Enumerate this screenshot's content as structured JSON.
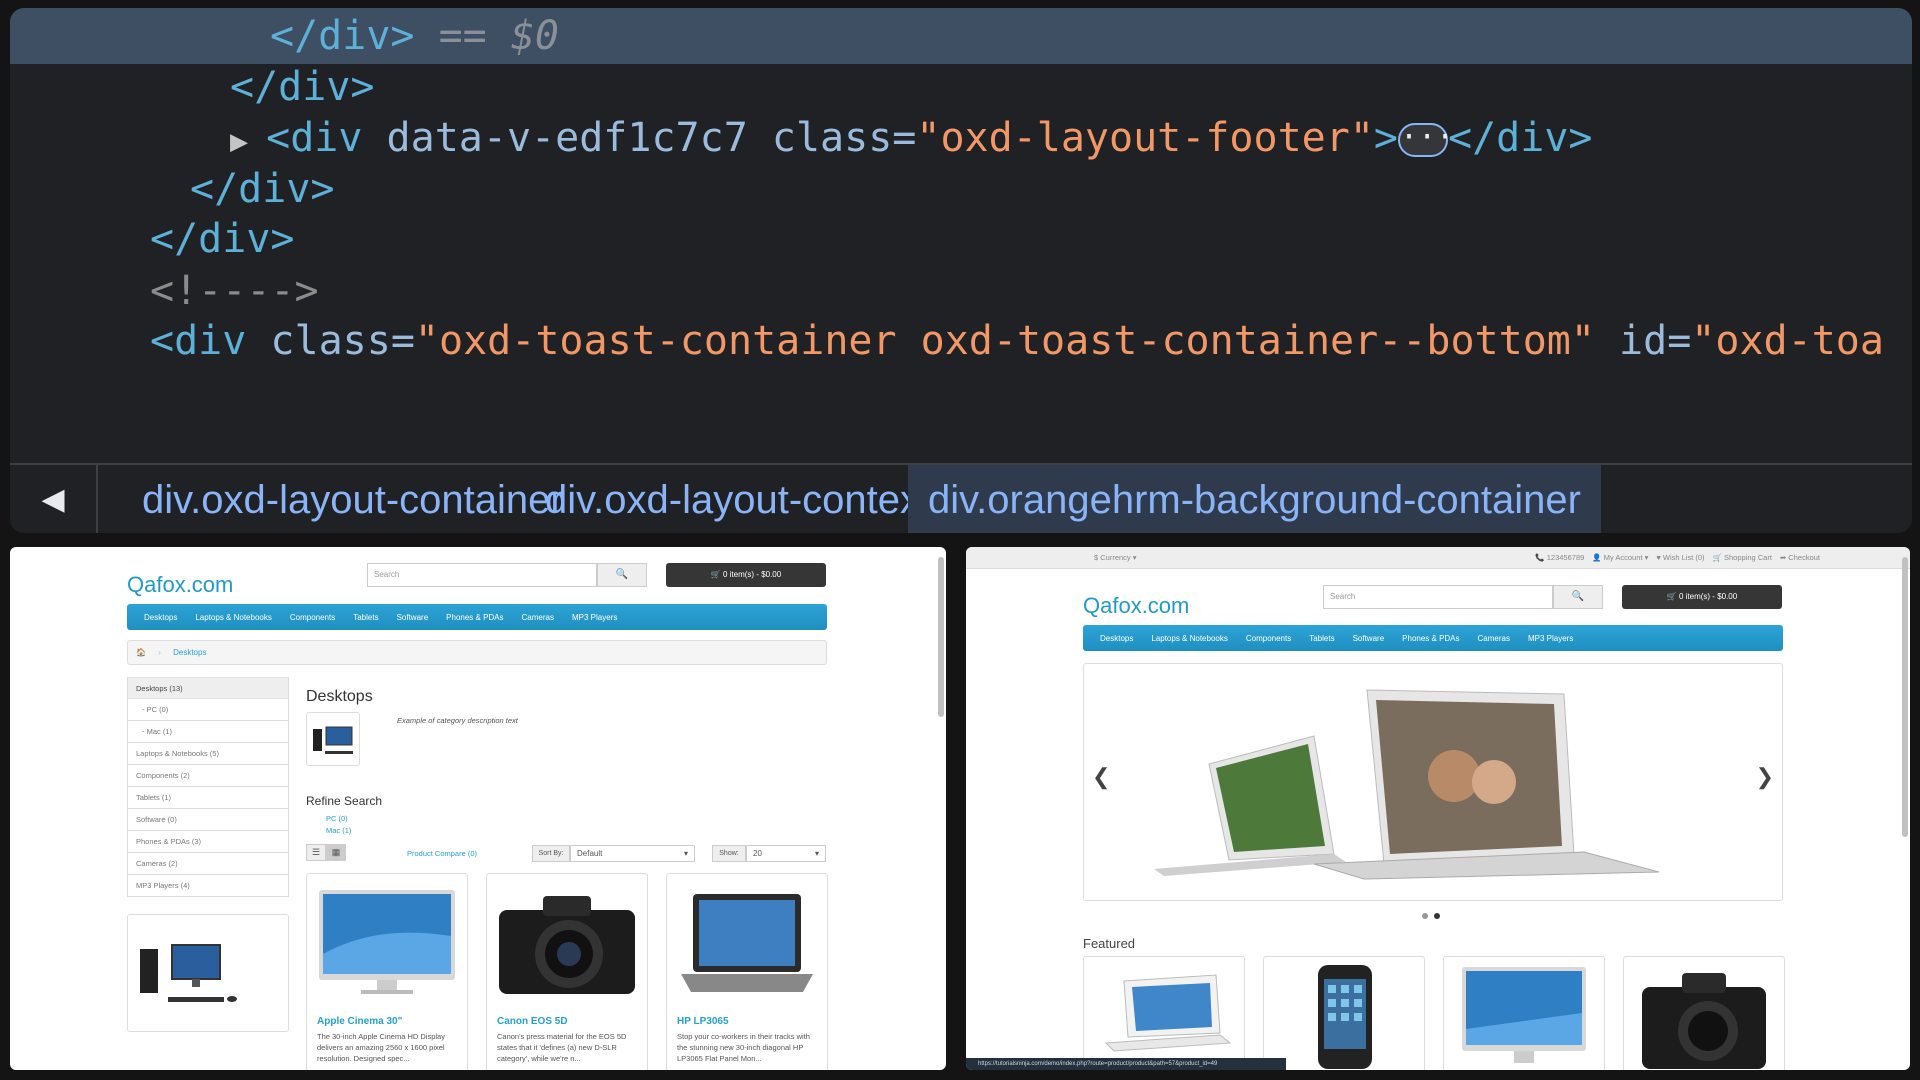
{
  "devtools": {
    "lines": [
      {
        "indent": 13,
        "parts": [
          [
            "tag",
            "</div>"
          ],
          [
            "dim",
            " == $0"
          ]
        ]
      },
      {
        "indent": 11,
        "parts": [
          [
            "tag",
            "</div>"
          ]
        ]
      },
      {
        "indent": 11,
        "parts": [
          [
            "tri",
            "▶ "
          ],
          [
            "tag",
            "<div "
          ],
          [
            "attr",
            "data-v-edf1c7c7 class="
          ],
          [
            "val",
            "\"oxd-layout-footer\""
          ],
          [
            "tag",
            ">"
          ],
          [
            "dots",
            "···"
          ],
          [
            "tag",
            "</div>"
          ]
        ]
      },
      {
        "indent": 9,
        "parts": [
          [
            "tag",
            "</div>"
          ]
        ]
      },
      {
        "indent": 7,
        "parts": [
          [
            "tag",
            "</div>"
          ]
        ]
      },
      {
        "indent": 7,
        "parts": [
          [
            "cm",
            "<!---->"
          ]
        ]
      },
      {
        "indent": 7,
        "parts": [
          [
            "tag",
            "<div "
          ],
          [
            "attr",
            "class="
          ],
          [
            "val",
            "\"oxd-toast-container oxd-toast-container--bottom\""
          ],
          [
            "attr",
            " id="
          ],
          [
            "val",
            "\"oxd-toa"
          ]
        ]
      }
    ],
    "back_icon": "◀",
    "breadcrumbs": [
      "div.oxd-layout-container",
      "div.oxd-layout-context",
      "div.orangehrm-background-container"
    ]
  },
  "store_left": {
    "logo": "Qafox.com",
    "search_placeholder": "Search",
    "cart": "🛒 0 item(s) - $0.00",
    "menu": [
      "Desktops",
      "Laptops & Notebooks",
      "Components",
      "Tablets",
      "Software",
      "Phones & PDAs",
      "Cameras",
      "MP3 Players"
    ],
    "breadcrumb": "Desktops",
    "sidebar": [
      "Desktops (13)",
      "- PC (0)",
      "- Mac (1)",
      "Laptops & Notebooks (5)",
      "Components (2)",
      "Tablets (1)",
      "Software (0)",
      "Phones & PDAs (3)",
      "Cameras (2)",
      "MP3 Players (4)"
    ],
    "heading": "Desktops",
    "description": "Example of category description text",
    "refine": "Refine Search",
    "refine_links": [
      "PC (0)",
      "Mac (1)"
    ],
    "compare": "Product Compare (0)",
    "sort_label": "Sort By:",
    "sort_value": "Default",
    "show_label": "Show:",
    "show_value": "20",
    "products": [
      {
        "name": "Apple Cinema 30\"",
        "desc": "The 30-inch Apple Cinema HD Display delivers an amazing 2560 x 1600 pixel resolution. Designed spec..."
      },
      {
        "name": "Canon EOS 5D",
        "desc": "Canon's press material for the EOS 5D states that it 'defines (a) new D-SLR category', while we're n..."
      },
      {
        "name": "HP LP3065",
        "desc": "Stop your co-workers in their tracks with the stunning new 30-inch diagonal HP LP3065 Flat Panel Mon..."
      }
    ]
  },
  "store_right": {
    "currency": "$ Currency ▾",
    "top_links": [
      "📞 123456789",
      "👤 My Account ▾",
      "♥ Wish List (0)",
      "🛒 Shopping Cart",
      "➦ Checkout"
    ],
    "logo": "Qafox.com",
    "search_placeholder": "Search",
    "cart": "🛒 0 item(s) - $0.00",
    "menu": [
      "Desktops",
      "Laptops & Notebooks",
      "Components",
      "Tablets",
      "Software",
      "Phones & PDAs",
      "Cameras",
      "MP3 Players"
    ],
    "prev": "❮",
    "next": "❯",
    "featured": "Featured",
    "status_url": "https://tutorialsninja.com/demo/index.php?route=product/product&path=57&product_id=49"
  }
}
